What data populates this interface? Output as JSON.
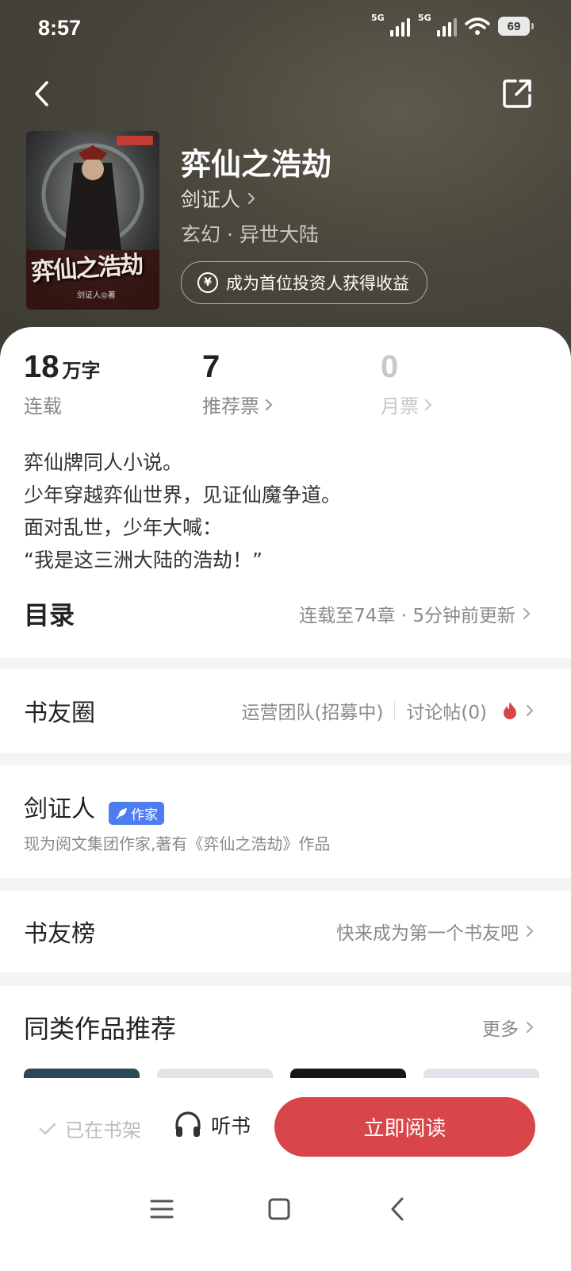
{
  "status_bar": {
    "time": "8:57",
    "net1": "5G",
    "net2": "5G",
    "battery": "69"
  },
  "book": {
    "title": "弈仙之浩劫",
    "author": "剑证人",
    "genre": "玄幻 · 异世大陆",
    "invest_label": "成为首位投资人获得收益",
    "cover_title": "弈仙之浩劫",
    "cover_author": "剑证人◎著"
  },
  "stats": {
    "words": {
      "value": "18",
      "unit": "万字",
      "label": "连载"
    },
    "recommend": {
      "value": "7",
      "label": "推荐票"
    },
    "monthly": {
      "value": "0",
      "label": "月票"
    }
  },
  "description": [
    "弈仙牌同人小说。",
    "少年穿越弈仙世界，见证仙魔争道。",
    "面对乱世，少年大喊：",
    "“我是这三洲大陆的浩劫！”"
  ],
  "toc": {
    "title": "目录",
    "info": "连载至74章 · 5分钟前更新"
  },
  "circle": {
    "title": "书友圈",
    "team": "运营团队(招募中)",
    "posts": "讨论帖(0)"
  },
  "author_card": {
    "name": "剑证人",
    "badge": "作家",
    "bio": "现为阅文集团作家,著有《弈仙之浩劫》作品"
  },
  "fans": {
    "title": "书友榜",
    "info": "快来成为第一个书友吧"
  },
  "similar": {
    "title": "同类作品推荐",
    "more": "更多"
  },
  "bottom": {
    "shelf": "已在书架",
    "listen": "听书",
    "read": "立即阅读"
  },
  "colors": {
    "accent": "#d8464a",
    "badge": "#4e7df0"
  }
}
